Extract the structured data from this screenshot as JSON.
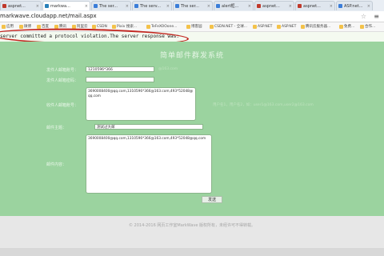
{
  "tabs": [
    {
      "label": "aspnet...",
      "color": "#c0392b"
    },
    {
      "label": "markwa...",
      "color": "#2980b9"
    },
    {
      "label": "The ser...",
      "color": "#3b7dd8"
    },
    {
      "label": "The serv...",
      "color": "#3b7dd8"
    },
    {
      "label": "The ser...",
      "color": "#3b7dd8"
    },
    {
      "label": "alert框...",
      "color": "#3b7dd8"
    },
    {
      "label": "aspnet...",
      "color": "#c0392b"
    },
    {
      "label": "aspnet...",
      "color": "#c0392b"
    },
    {
      "label": "ASP.net...",
      "color": "#3b7dd8"
    }
  ],
  "browser": {
    "url": "markwave.cloudapp.net/mail.aspx",
    "star": "☆",
    "menu": "≡"
  },
  "bookmarks": [
    "应用",
    "微博",
    "百度",
    "腾讯",
    "阿里云",
    "CSDN",
    "Pixiv 搜索...",
    "TeFeXOOone...",
    "博客园",
    "CSDN.NET - 全球...",
    "ASP.NET",
    "ASP.NET",
    "腾讯云服务器...",
    "免费...",
    "合作..."
  ],
  "error": {
    "message": "server committed a protocol violation.The server response was:"
  },
  "page": {
    "title": "简单邮件群发系统",
    "labels": {
      "from": "发件人邮箱账号：",
      "password": "发件人邮箱密码：",
      "to": "收件人邮箱账号：",
      "subject": "邮件主题：",
      "body": "邮件内容："
    },
    "fields": {
      "from": "1210596*366",
      "password": "",
      "to": "3690008400@qq.com,1310596*366@163.com,493*52048@qq.com",
      "subject": "测试过大邮",
      "body": "3690008400@qq.com,1310596*366@163.com,493*52048@qq.com"
    },
    "hints": {
      "from": "@163.com",
      "to": "用户名1，用户名2，如：user1@163.com,user2@163.com"
    },
    "send_label": "发送"
  },
  "footer": {
    "copyright": "© 2014-2016 网页工作室MarkWave 版权所有，未经许可不得转载。"
  },
  "colors": {
    "error_oval": "#c2261f",
    "page_green": "#9bd39f"
  }
}
